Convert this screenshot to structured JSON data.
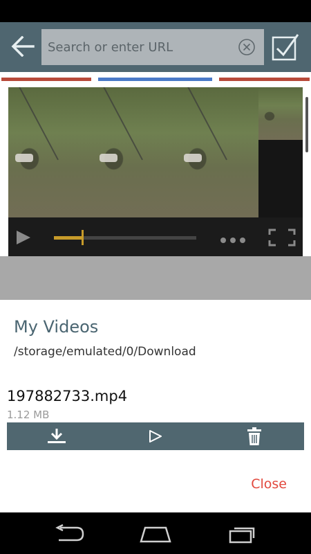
{
  "search": {
    "placeholder": "Search or enter URL",
    "value": ""
  },
  "tabs": [
    {
      "color": "#b84a3a"
    },
    {
      "color": "#4a7ac8"
    },
    {
      "color": "#b84a3a"
    }
  ],
  "player": {
    "progress": 0.2
  },
  "dialog": {
    "title": "My Videos",
    "path": "/storage/emulated/0/Download",
    "file": {
      "name": "197882733.mp4",
      "size": "1.12 MB"
    },
    "close_label": "Close"
  },
  "icons": {
    "back": "arrow-left-icon",
    "clear": "circle-x-icon",
    "confirm": "checkbox-icon",
    "play": "play-icon",
    "more": "more-dots-icon",
    "fullscreen": "fullscreen-icon",
    "download": "download-icon",
    "play_outline": "play-outline-icon",
    "delete": "trash-icon"
  },
  "colors": {
    "toolbar": "#4f6670",
    "accent_progress": "#c79b2a",
    "close": "#e2483d",
    "title": "#4a6571"
  }
}
